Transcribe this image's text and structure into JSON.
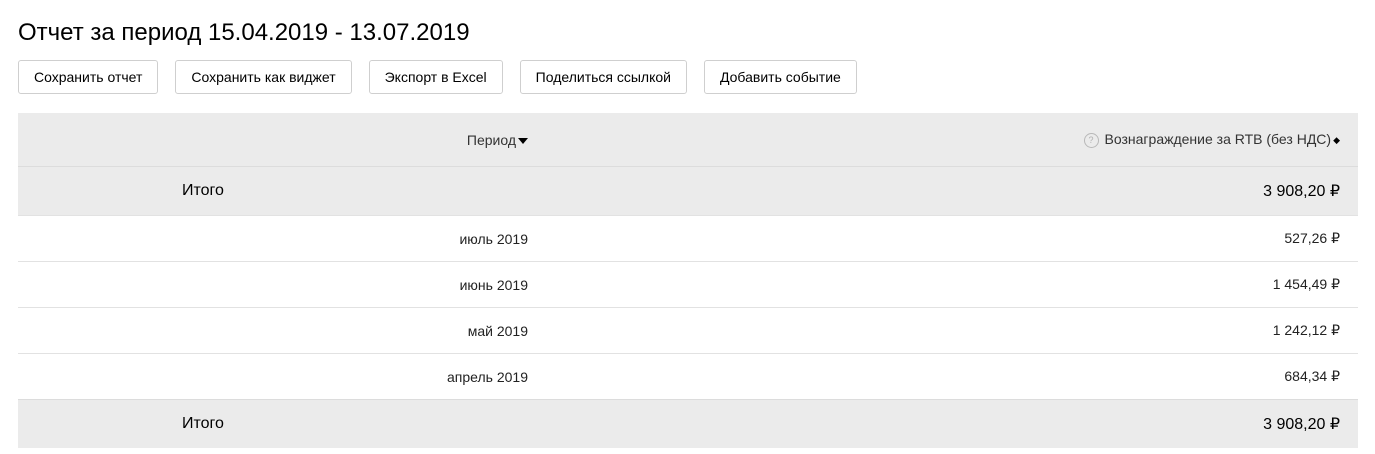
{
  "page": {
    "title": "Отчет за период 15.04.2019 - 13.07.2019"
  },
  "toolbar": {
    "save_report": "Сохранить отчет",
    "save_widget": "Сохранить как виджет",
    "export_excel": "Экспорт в Excel",
    "share_link": "Поделиться ссылкой",
    "add_event": "Добавить событие"
  },
  "table": {
    "columns": {
      "period": "Период",
      "reward": "Вознаграждение за RTB (без НДС)"
    },
    "total_top": {
      "label": "Итого",
      "value": "3 908,20 ₽"
    },
    "rows": [
      {
        "period": "июль 2019",
        "value": "527,26 ₽"
      },
      {
        "period": "июнь 2019",
        "value": "1 454,49 ₽"
      },
      {
        "period": "май 2019",
        "value": "1 242,12 ₽"
      },
      {
        "period": "апрель 2019",
        "value": "684,34 ₽"
      }
    ],
    "total_bottom": {
      "label": "Итого",
      "value": "3 908,20 ₽"
    }
  },
  "icons": {
    "sort_period": "caret-down-icon",
    "sort_reward": "sort-both-icon",
    "help": "question-circle-icon"
  }
}
